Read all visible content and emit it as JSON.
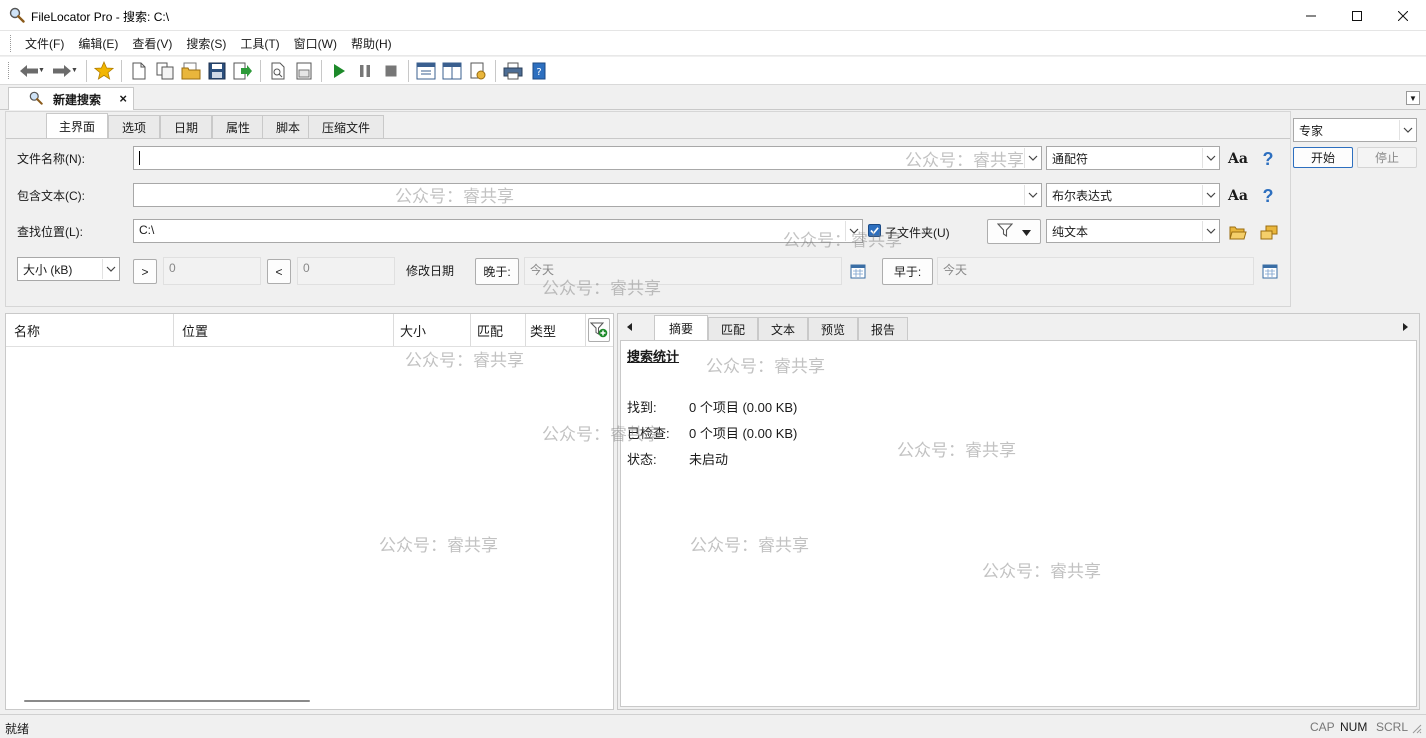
{
  "window": {
    "title": "FileLocator Pro - 搜索: C:\\"
  },
  "menu": [
    "文件(F)",
    "编辑(E)",
    "查看(V)",
    "搜索(S)",
    "工具(T)",
    "窗口(W)",
    "帮助(H)"
  ],
  "doc_tab": {
    "label": "新建搜索",
    "close": "×"
  },
  "search_tabs": [
    "主界面",
    "选项",
    "日期",
    "属性",
    "脚本",
    "压缩文件"
  ],
  "form": {
    "filename_label": "文件名称(N):",
    "filename_value": "",
    "filename_mode": "通配符",
    "contains_label": "包含文本(C):",
    "contains_value": "",
    "contains_mode": "布尔表达式",
    "location_label": "查找位置(L):",
    "location_value": "C:\\",
    "subfolders_label": "子文件夹(U)",
    "subfolders_checked": true,
    "filetype_mode": "纯文本",
    "case_label": "Aa",
    "help_label": "?",
    "size_unit": "大小 (kB)",
    "gt_label": ">",
    "gt_value": "0",
    "lt_label": "<",
    "lt_value": "0",
    "modified_label": "修改日期",
    "after_label": "晚于:",
    "after_value": "今天",
    "before_label": "早于:",
    "before_value": "今天"
  },
  "side": {
    "mode": "专家",
    "start": "开始",
    "stop": "停止"
  },
  "results": {
    "columns": [
      "名称",
      "位置",
      "大小",
      "匹配",
      "类型"
    ]
  },
  "detail": {
    "tabs": [
      "摘要",
      "匹配",
      "文本",
      "预览",
      "报告"
    ],
    "heading": "搜索统计",
    "stats": [
      {
        "label": "找到:",
        "value": "0 个项目 (0.00 KB)"
      },
      {
        "label": "已检查:",
        "value": "0 个项目 (0.00 KB)"
      },
      {
        "label": "状态:",
        "value": "未启动"
      }
    ]
  },
  "statusbar": {
    "text": "就绪",
    "indicators": [
      "CAP",
      "NUM",
      "SCRL"
    ]
  },
  "watermark": "公众号：睿共享",
  "colors": {
    "accent_blue": "#2d6fbf",
    "play_green": "#1d8a2a",
    "star_gold": "#f2b600",
    "folder_yellow": "#e9b63c"
  }
}
